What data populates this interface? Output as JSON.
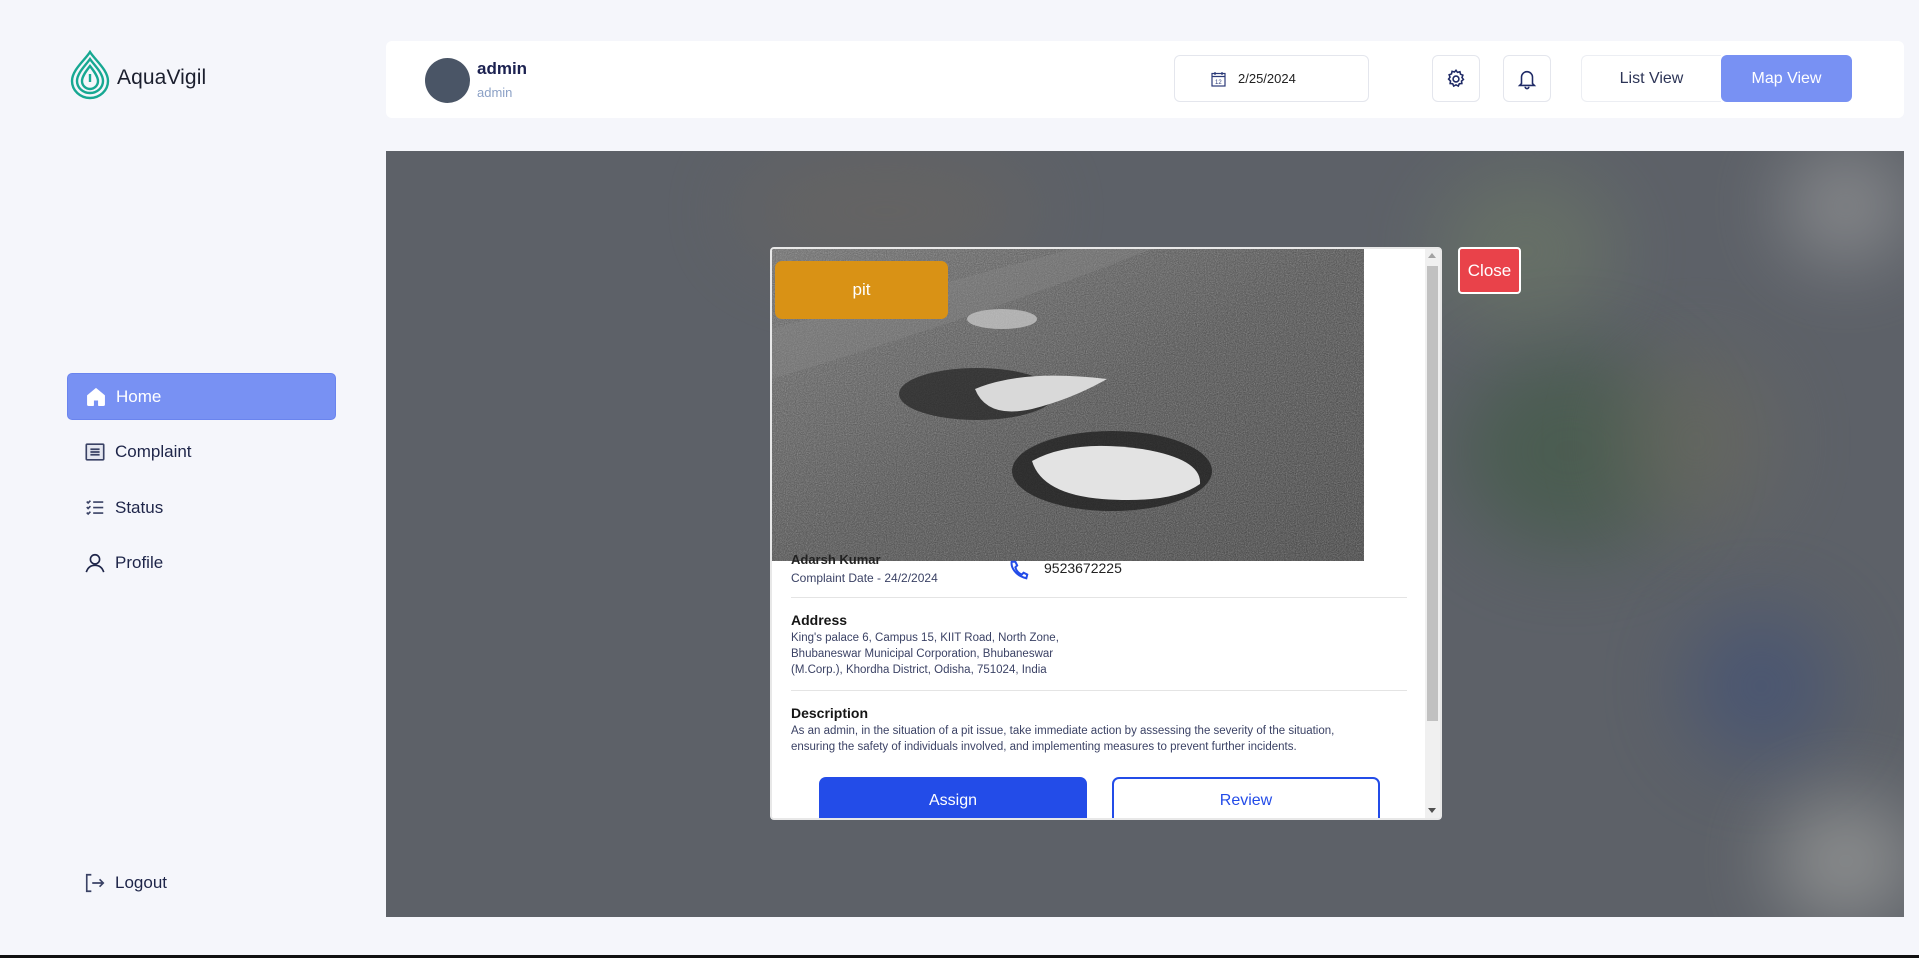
{
  "app": {
    "name": "AquaVigil",
    "logo_icon": "water-drop-spiral-icon",
    "brand_color": "#17a892"
  },
  "sidebar": {
    "items": [
      {
        "label": "Home",
        "icon": "home-icon",
        "active": true
      },
      {
        "label": "Complaint",
        "icon": "list-box-icon",
        "active": false
      },
      {
        "label": "Status",
        "icon": "checklist-icon",
        "active": false
      },
      {
        "label": "Profile",
        "icon": "user-icon",
        "active": false
      }
    ],
    "logout_label": "Logout",
    "logout_icon": "logout-icon",
    "active_color": "#7891f3"
  },
  "header": {
    "user_name": "admin",
    "user_role": "admin",
    "date": "2/25/2024",
    "date_icon": "calendar-icon",
    "settings_icon": "gear-icon",
    "notifications_icon": "bell-icon",
    "list_view_label": "List View",
    "map_view_label": "Map View",
    "active_view": "Map View"
  },
  "modal": {
    "category_tag": "pit",
    "category_color": "#d99215",
    "photo_description": "Road with water-filled potholes",
    "reporter_name": "Adarsh Kumar",
    "complaint_date": "Complaint Date - 24/2/2024",
    "phone_icon": "phone-icon",
    "phone": "9523672225",
    "address_title": "Address",
    "address_lines": [
      "King's palace 6, Campus 15, KIIT Road, North Zone,",
      "Bhubaneswar Municipal Corporation, Bhubaneswar",
      "(M.Corp.), Khordha District, Odisha, 751024, India"
    ],
    "description_title": "Description",
    "description_lines": [
      "As an admin, in the situation of a pit issue, take immediate action by assessing the severity of the situation,",
      "ensuring the safety of individuals involved, and implementing measures to prevent further incidents."
    ],
    "assign_label": "Assign",
    "review_label": "Review",
    "close_label": "Close",
    "primary_color": "#234ce8",
    "close_color": "#e9424a"
  }
}
